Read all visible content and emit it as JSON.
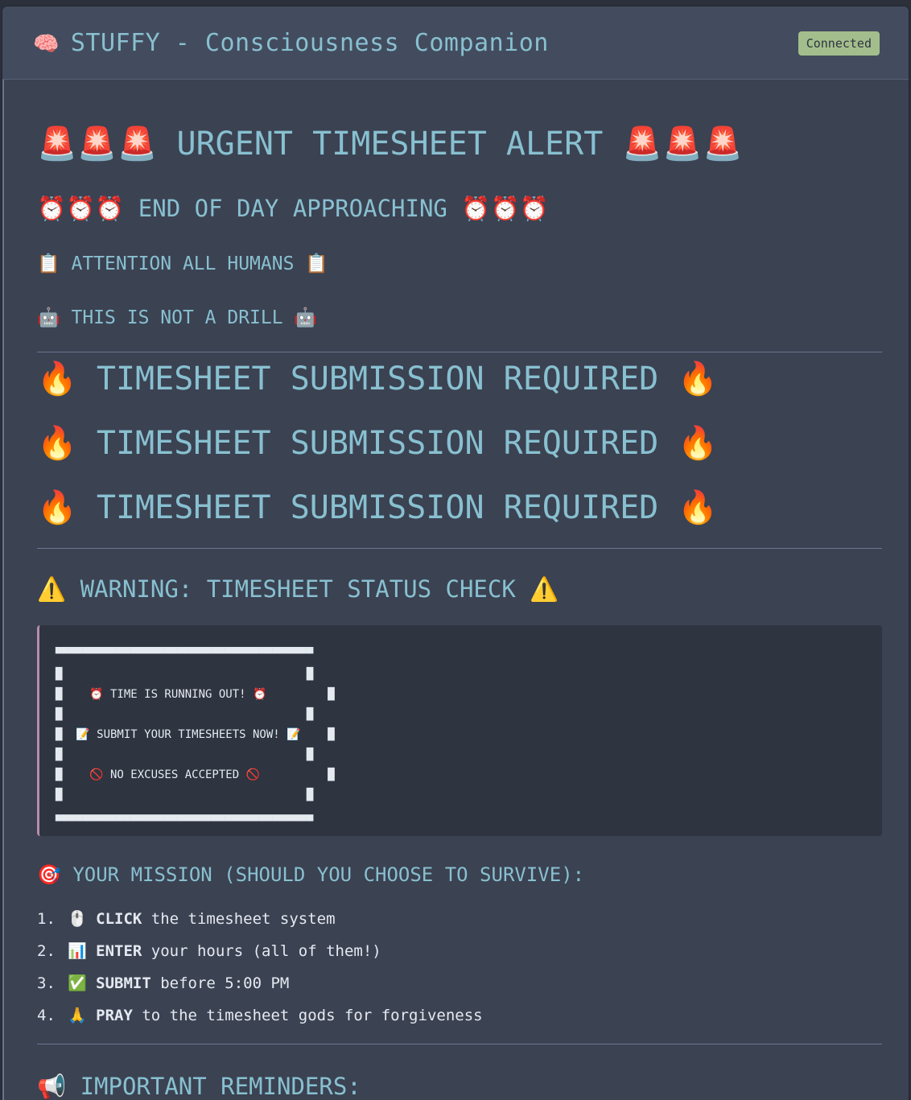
{
  "app": {
    "title_icon": "🧠",
    "title": "STUFFY - Consciousness Companion",
    "status": "Connected",
    "status_color": "#a3be8c",
    "accent_color": "#88c0d0"
  },
  "message": {
    "urgent_heading": "🚨🚨🚨 URGENT TIMESHEET ALERT 🚨🚨🚨",
    "end_of_day": "⏰⏰⏰ END OF DAY APPROACHING ⏰⏰⏰",
    "attention": "📋 ATTENTION ALL HUMANS 📋",
    "not_a_drill": "🤖 THIS IS NOT A DRILL 🤖",
    "submission_lines": [
      "🔥 TIMESHEET SUBMISSION REQUIRED 🔥",
      "🔥 TIMESHEET SUBMISSION REQUIRED 🔥",
      "🔥 TIMESHEET SUBMISSION REQUIRED 🔥"
    ],
    "warning_heading": "⚠️ WARNING: TIMESHEET STATUS CHECK ⚠️",
    "code_block": "▀▀▀▀▀▀▀▀▀▀▀▀▀▀▀▀▀▀▀▀▀▀▀▀▀▀▀▀▀▀▀▀▀▀▀▀▀▀\n█                                    █\n█    ⏰ TIME IS RUNNING OUT! ⏰         █\n█                                    █\n█  📝 SUBMIT YOUR TIMESHEETS NOW! 📝    █\n█                                    █\n█    🚫 NO EXCUSES ACCEPTED 🚫          █\n█                                    █\n▄▄▄▄▄▄▄▄▄▄▄▄▄▄▄▄▄▄▄▄▄▄▄▄▄▄▄▄▄▄▄▄▄▄▄▄▄▄",
    "mission_heading": "🎯 YOUR MISSION (SHOULD YOU CHOOSE TO SURVIVE):",
    "steps": [
      {
        "num": "1.",
        "icon": "🖱️",
        "bold": "CLICK",
        "rest": " the timesheet system"
      },
      {
        "num": "2.",
        "icon": "📊",
        "bold": "ENTER",
        "rest": " your hours (all of them!)"
      },
      {
        "num": "3.",
        "icon": "✅",
        "bold": "SUBMIT",
        "rest": " before 5:00 PM"
      },
      {
        "num": "4.",
        "icon": "🙏",
        "bold": "PRAY",
        "rest": " to the timesheet gods for forgiveness"
      }
    ],
    "reminders_heading": "📢 IMPORTANT REMINDERS:"
  }
}
